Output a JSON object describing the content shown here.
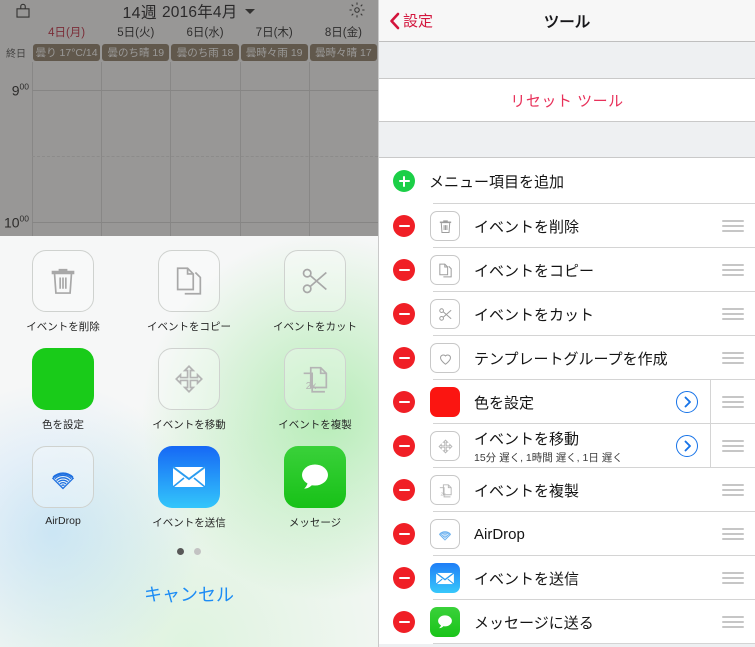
{
  "calendar": {
    "bag_icon": "bag-icon",
    "gear_icon": "gear-icon",
    "week_label": "14週",
    "month_label": "2016年4月",
    "caret_icon": "chevron-down-icon",
    "allday_label": "終日",
    "days": [
      {
        "label": "4日(月)",
        "today": true
      },
      {
        "label": "5日(火)",
        "today": false
      },
      {
        "label": "6日(水)",
        "today": false
      },
      {
        "label": "7日(木)",
        "today": false
      },
      {
        "label": "8日(金)",
        "today": false
      }
    ],
    "weather": [
      "曇り 17°C/14",
      "曇のち晴 19",
      "曇のち雨 18",
      "曇時々雨 19",
      "曇時々晴 17"
    ],
    "hours": [
      "9",
      "10"
    ],
    "hour_minutes": "00",
    "weather_color": "#8a7a62",
    "today_color": "#c0223a"
  },
  "sheet": {
    "items": [
      {
        "label": "イベントを削除",
        "icon": "trash-icon",
        "style": "outline"
      },
      {
        "label": "イベントをコピー",
        "icon": "copy-icon",
        "style": "outline"
      },
      {
        "label": "イベントをカット",
        "icon": "scissors-icon",
        "style": "outline"
      },
      {
        "label": "色を設定",
        "icon": "color-swatch-icon",
        "style": "green"
      },
      {
        "label": "イベントを移動",
        "icon": "move-arrows-icon",
        "style": "outline"
      },
      {
        "label": "イベントを複製",
        "icon": "duplicate-2x-icon",
        "style": "outline"
      },
      {
        "label": "AirDrop",
        "icon": "airdrop-icon",
        "style": "outline"
      },
      {
        "label": "イベントを送信",
        "icon": "mail-icon",
        "style": "mail"
      },
      {
        "label": "メッセージ",
        "icon": "messages-icon",
        "style": "msg"
      }
    ],
    "page_dots": 2,
    "active_dot": 0,
    "cancel_label": "キャンセル",
    "cancel_color": "#1c8cf5",
    "swatch_color": "#19cb19"
  },
  "settings": {
    "back_label": "設定",
    "back_icon": "chevron-left-icon",
    "title": "ツール",
    "back_color": "#d3143c",
    "reset_label": "リセット ツール",
    "reset_color": "#e8315a",
    "add_row": {
      "label": "メニュー項目を追加",
      "icon": "plus-circle-icon"
    },
    "rows": [
      {
        "label": "イベントを削除",
        "sub": "",
        "icon": "trash-icon",
        "style": "outline",
        "chevron": false
      },
      {
        "label": "イベントをコピー",
        "sub": "",
        "icon": "copy-icon",
        "style": "outline",
        "chevron": false
      },
      {
        "label": "イベントをカット",
        "sub": "",
        "icon": "scissors-icon",
        "style": "outline",
        "chevron": false
      },
      {
        "label": "テンプレートグループを作成",
        "sub": "",
        "icon": "heart-icon",
        "style": "outline",
        "chevron": false
      },
      {
        "label": "色を設定",
        "sub": "",
        "icon": "color-swatch-icon",
        "style": "red",
        "chevron": true
      },
      {
        "label": "イベントを移動",
        "sub": "15分 遅く, 1時間 遅く, 1日 遅く",
        "icon": "move-arrows-icon",
        "style": "outline",
        "chevron": true
      },
      {
        "label": "イベントを複製",
        "sub": "",
        "icon": "duplicate-2x-icon",
        "style": "outline",
        "chevron": false
      },
      {
        "label": "AirDrop",
        "sub": "",
        "icon": "airdrop-icon",
        "style": "airdrop",
        "chevron": false
      },
      {
        "label": "イベントを送信",
        "sub": "",
        "icon": "mail-icon",
        "style": "mail",
        "chevron": false
      },
      {
        "label": "メッセージに送る",
        "sub": "",
        "icon": "messages-icon",
        "style": "msg",
        "chevron": false
      }
    ],
    "remove_icon": "minus-circle-icon",
    "handle_icon": "reorder-handle-icon",
    "chevron_icon": "chevron-right-circle-icon",
    "swatch_color": "#fb1511"
  }
}
